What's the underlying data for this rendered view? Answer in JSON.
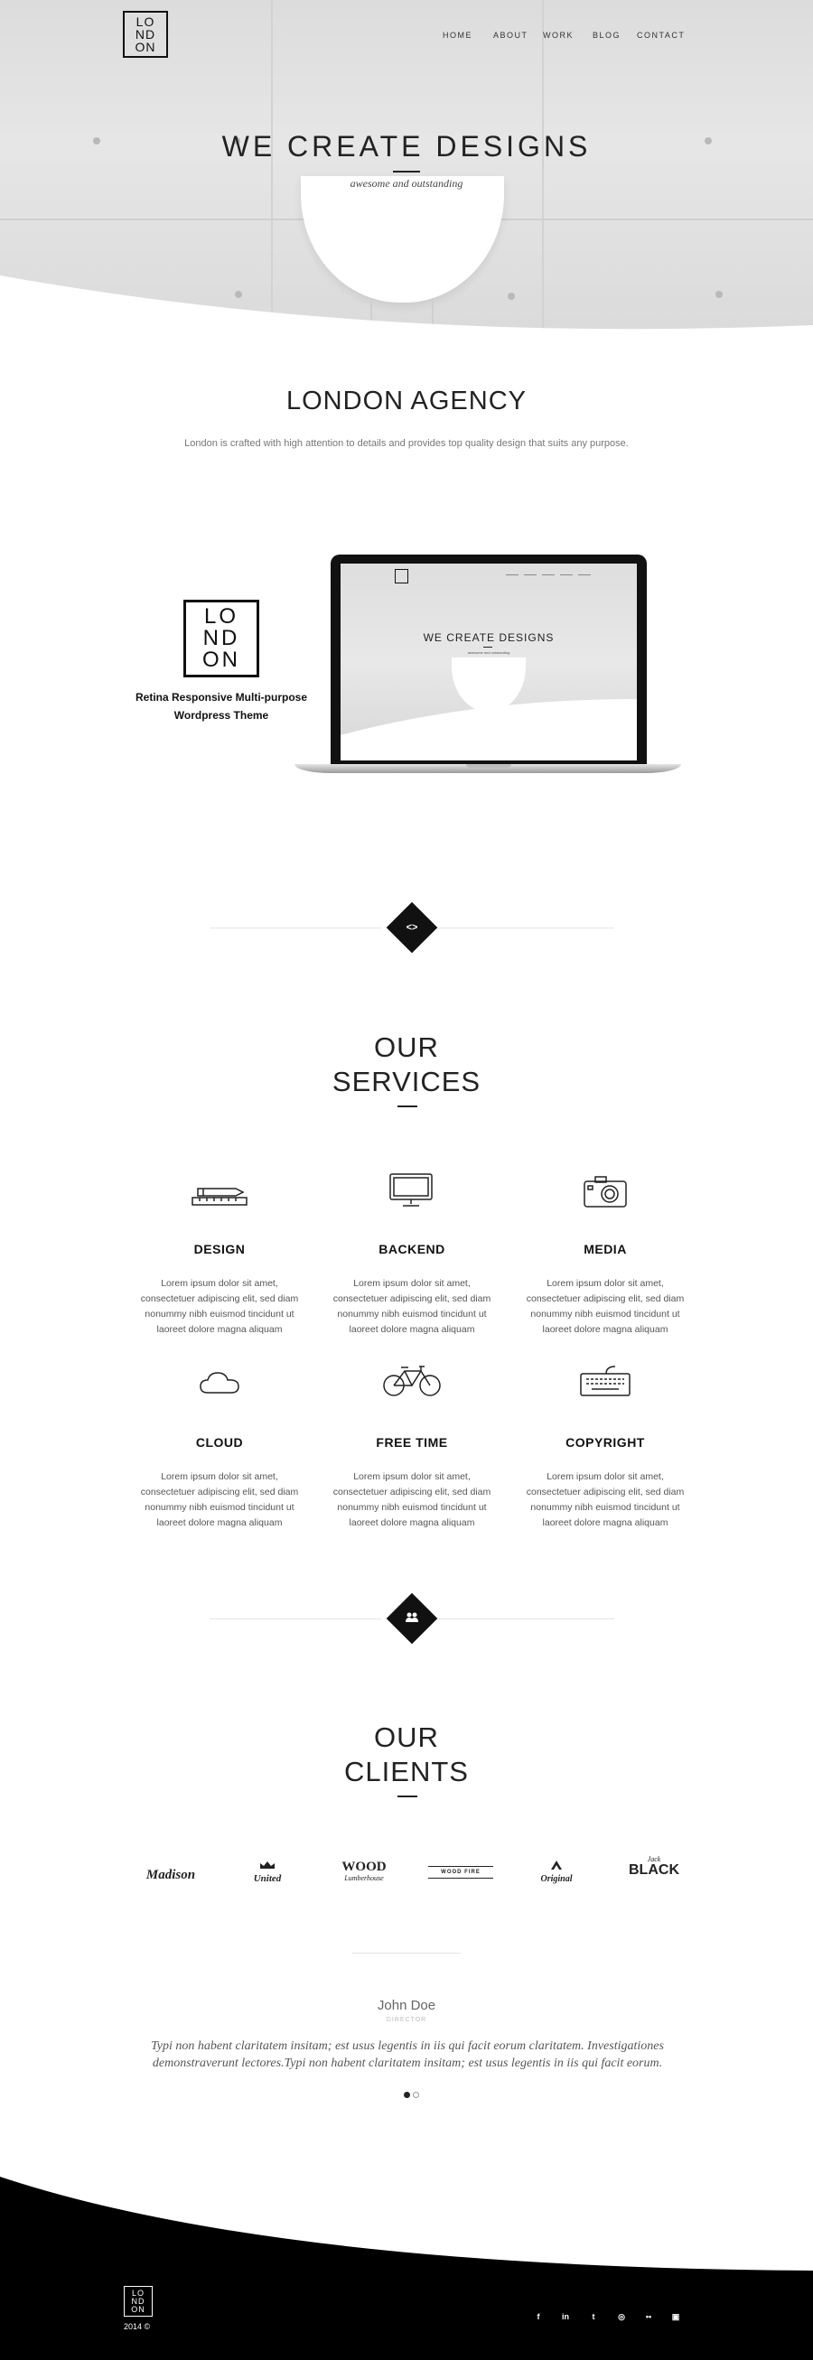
{
  "logo": {
    "text": "LONDON"
  },
  "nav": {
    "items": [
      "HOME",
      "ABOUT",
      "WORK",
      "BLOG",
      "CONTACT"
    ]
  },
  "hero": {
    "title": "WE CREATE DESIGNS",
    "subtitle": "awesome and outstanding"
  },
  "about": {
    "title": "LONDON AGENCY",
    "text": "London is crafted with high attention to details and provides top quality design that suits any purpose."
  },
  "showcase": {
    "logo_text": "LONDON",
    "caption_line1": "Retina Responsive Multi-purpose",
    "caption_line2": "Wordpress Theme",
    "screen_title": "WE CREATE DESIGNS",
    "screen_subtitle": "awesome and outstanding"
  },
  "divider1": {
    "icon": "code-icon",
    "glyph": "<>"
  },
  "services": {
    "title_line1": "OUR",
    "title_line2": "SERVICES",
    "items": [
      {
        "name": "DESIGN",
        "icon": "pencil-ruler-icon",
        "text": "Lorem ipsum dolor sit amet, consectetuer adipiscing elit, sed diam nonummy nibh euismod tincidunt ut laoreet dolore magna aliquam"
      },
      {
        "name": "BACKEND",
        "icon": "monitor-icon",
        "text": "Lorem ipsum dolor sit amet, consectetuer adipiscing elit, sed diam nonummy nibh euismod tincidunt ut laoreet dolore magna aliquam"
      },
      {
        "name": "MEDIA",
        "icon": "camera-icon",
        "text": "Lorem ipsum dolor sit amet, consectetuer adipiscing elit, sed diam nonummy nibh euismod tincidunt ut laoreet dolore magna aliquam"
      },
      {
        "name": "CLOUD",
        "icon": "cloud-icon",
        "text": "Lorem ipsum dolor sit amet, consectetuer adipiscing elit, sed diam nonummy nibh euismod tincidunt ut laoreet dolore magna aliquam"
      },
      {
        "name": "FREE TIME",
        "icon": "bicycle-icon",
        "text": "Lorem ipsum dolor sit amet, consectetuer adipiscing elit, sed diam nonummy nibh euismod tincidunt ut laoreet dolore magna aliquam"
      },
      {
        "name": "COPYRIGHT",
        "icon": "keyboard-icon",
        "text": "Lorem ipsum dolor sit amet, consectetuer adipiscing elit, sed diam nonummy nibh euismod tincidunt ut laoreet dolore magna aliquam"
      }
    ]
  },
  "divider2": {
    "icon": "users-icon",
    "glyph": "👥"
  },
  "clients": {
    "title_line1": "OUR",
    "title_line2": "CLIENTS",
    "logos": [
      "Madison",
      "United",
      "WOOD",
      "WOOD FIRE",
      "Original",
      "BLACK"
    ],
    "logo_sub": {
      "wood": "Lumberhouse",
      "jack": "Jack"
    }
  },
  "testimonial": {
    "name": "John Doe",
    "role": "DIRECTOR",
    "quote": "Typi non habent claritatem insitam; est usus legentis in iis qui facit eorum claritatem. Investigationes demonstraverunt lectores.Typi non habent claritatem insitam; est usus legentis in iis qui facit eorum."
  },
  "footer": {
    "logo_text": "LONDON",
    "year": "2014 ©",
    "social": [
      "facebook-icon",
      "linkedin-icon",
      "twitter-icon",
      "dribbble-icon",
      "flickr-icon",
      "instagram-icon"
    ],
    "social_glyphs": [
      "f",
      "in",
      "t",
      "◎",
      "••",
      "▣"
    ]
  },
  "colors": {
    "accent": "#111111",
    "background": "#ffffff",
    "text_muted": "#777777"
  }
}
